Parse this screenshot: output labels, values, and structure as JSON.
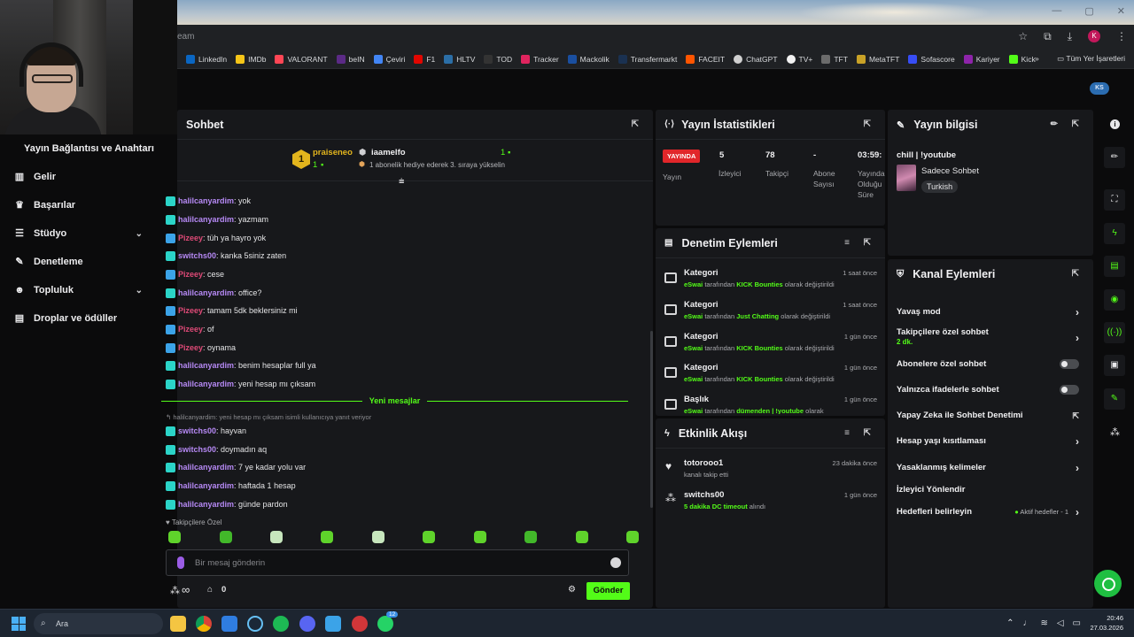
{
  "browser": {
    "address_fragment": "eam",
    "bookmarks": [
      "LinkedIn",
      "IMDb",
      "VALORANT",
      "beIN",
      "Çeviri",
      "F1",
      "HLTV",
      "TOD",
      "Tracker",
      "Mackolik",
      "Transfermarkt",
      "FACEIT",
      "ChatGPT",
      "TV+",
      "TFT",
      "MetaTFT",
      "Sofascore",
      "Kariyer",
      "Kick"
    ],
    "bookmarks_more": "»",
    "all_bookmarks": "Tüm Yer İşaretleri"
  },
  "brand": {
    "logo_text": "KS"
  },
  "sidebar": {
    "title": "Yayın Bağlantısı ve Anahtarı",
    "items": [
      {
        "label": "Gelir",
        "icon": "bar-chart-icon"
      },
      {
        "label": "Başarılar",
        "icon": "trophy-icon"
      },
      {
        "label": "Stüdyo",
        "icon": "sliders-icon",
        "chevron": "⌄"
      },
      {
        "label": "Denetleme",
        "icon": "wrench-icon"
      },
      {
        "label": "Topluluk",
        "icon": "users-icon",
        "chevron": "⌄"
      },
      {
        "label": "Droplar ve ödüller",
        "icon": "gift-icon"
      }
    ]
  },
  "chat": {
    "title": "Sohbet",
    "pinned": {
      "rank": "1",
      "gifter": "praiseneo",
      "gifter_count": "1",
      "recipient": "iaamelfo",
      "recipient_count": "1",
      "description": "1 abonelik hediye ederek 3. sıraya yükselin"
    },
    "messages": [
      {
        "user": "halilcanyardim",
        "text": ": yok",
        "style": "u1",
        "color": "#2bd4c8"
      },
      {
        "user": "halilcanyardim",
        "text": ": yazmam",
        "style": "u1",
        "color": "#2bd4c8"
      },
      {
        "user": "Pizeey",
        "text": ": tüh ya hayro yok",
        "style": "u2",
        "color": "#3ba3e8"
      },
      {
        "user": "switchs00",
        "text": ": kanka 5siniz zaten",
        "style": "u3",
        "color": "#2bd4c8"
      },
      {
        "user": "Pizeey",
        "text": ": cese",
        "style": "u2",
        "color": "#3ba3e8"
      },
      {
        "user": "halilcanyardim",
        "text": ": office?",
        "style": "u1",
        "color": "#2bd4c8"
      },
      {
        "user": "Pizeey",
        "text": ": tamam 5dk beklersiniz mi",
        "style": "u2",
        "color": "#3ba3e8"
      },
      {
        "user": "Pizeey",
        "text": ": of",
        "style": "u2",
        "color": "#3ba3e8"
      },
      {
        "user": "Pizeey",
        "text": ": oynama",
        "style": "u2",
        "color": "#3ba3e8"
      },
      {
        "user": "halilcanyardim",
        "text": ": benim hesaplar full ya",
        "style": "u1",
        "color": "#2bd4c8"
      },
      {
        "user": "halilcanyardim",
        "text": ": yeni hesap mı çıksam",
        "style": "u1",
        "color": "#2bd4c8"
      }
    ],
    "new_messages_label": "Yeni mesajlar",
    "reply_hint": "↰ halilcanyardim: yeni hesap mı çıksam isimli kullanıcıya yanıt veriyor",
    "new_messages": [
      {
        "user": "switchs00",
        "text": ": hayvan",
        "style": "u3",
        "color": "#2bd4c8"
      },
      {
        "user": "switchs00",
        "text": ": doymadın aq",
        "style": "u3",
        "color": "#2bd4c8"
      },
      {
        "user": "halilcanyardim",
        "text": ": 7 ye kadar yolu var",
        "style": "u1",
        "color": "#2bd4c8"
      },
      {
        "user": "halilcanyardim",
        "text": ": haftada 1 hesap",
        "style": "u1",
        "color": "#2bd4c8"
      },
      {
        "user": "halilcanyardim",
        "text": ": günde pardon",
        "style": "u1",
        "color": "#2bd4c8"
      }
    ],
    "followers_only": "Takipçilere Özel",
    "input_placeholder": "Bir mesaj gönderin",
    "infinity": "∞",
    "count": "0",
    "send_label": "Gönder"
  },
  "stats": {
    "title": "Yayın İstatistikleri",
    "live_badge": "YAYINDA",
    "live_label": "Yayın",
    "viewers_value": "5",
    "viewers_label": "İzleyici",
    "followers_value": "78",
    "followers_label": "Takipçi",
    "subs_value": "-",
    "subs_label": "Abone Sayısı",
    "uptime_value": "03:59:",
    "uptime_label": "Yayında Olduğu Süre"
  },
  "moderation": {
    "title": "Denetim Eylemleri",
    "events": [
      {
        "title": "Kategori",
        "actor": "eSwai",
        "mid": " tarafından ",
        "value": "KICK Bounties",
        "end": " olarak değiştirildi",
        "time": "1 saat önce"
      },
      {
        "title": "Kategori",
        "actor": "eSwai",
        "mid": " tarafından ",
        "value": "Just Chatting",
        "end": " olarak değiştirildi",
        "time": "1 saat önce"
      },
      {
        "title": "Kategori",
        "actor": "eSwai",
        "mid": " tarafından ",
        "value": "KICK Bounties",
        "end": " olarak değiştirildi",
        "time": "1 gün önce"
      },
      {
        "title": "Kategori",
        "actor": "eSwai",
        "mid": " tarafından ",
        "value": "KICK Bounties",
        "end": " olarak değiştirildi",
        "time": "1 gün önce"
      },
      {
        "title": "Başlık",
        "actor": "eSwai",
        "mid": " tarafından ",
        "value": "dümenden | !youtube",
        "end": " olarak",
        "time": "1 gün önce"
      }
    ]
  },
  "activity": {
    "title": "Etkinlik Akışı",
    "events": [
      {
        "user": "totorooo1",
        "desc": "kanalı takip etti",
        "time": "23 dakika önce"
      },
      {
        "user": "switchs00",
        "desc_green": "5 dakika DC timeout",
        "desc": " alındı",
        "time": "1 gün önce"
      }
    ]
  },
  "info": {
    "title": "Yayın bilgisi",
    "stream_title": "chill | !youtube",
    "category": "Sadece Sohbet",
    "language": "Turkish"
  },
  "channel": {
    "title": "Kanal Eylemleri",
    "slow_mode": "Yavaş mod",
    "followers_only": "Takipçilere özel sohbet",
    "followers_only_sub": "2 dk.",
    "subs_only": "Abonelere özel sohbet",
    "emotes_only": "Yalnızca ifadelerle sohbet",
    "ai_mod": "Yapay Zeka ile Sohbet Denetimi",
    "age_limit": "Hesap yaşı kısıtlaması",
    "banned_words": "Yasaklanmış kelimeler",
    "viewer_redirect": "İzleyici Yönlendir",
    "goals": "Hedefleri belirleyin",
    "goals_active": "Aktif hedefler - 1"
  },
  "taskbar": {
    "search_placeholder": "Ara",
    "time": "20:46",
    "date": "27.03.2026",
    "whatsapp_badge": "12"
  }
}
